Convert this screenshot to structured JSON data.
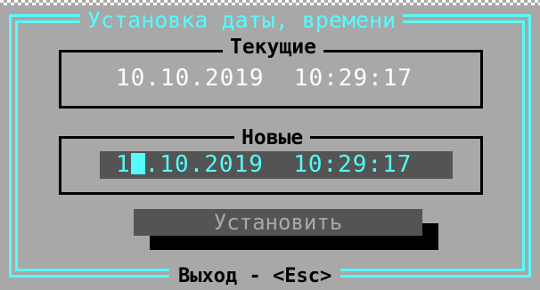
{
  "dialog": {
    "title": "Установка даты, времени",
    "accent_color": "#54fcfc",
    "background_color": "#a8a8a8"
  },
  "current": {
    "label": "Текущие",
    "value": "10.10.2019  10:29:17"
  },
  "new": {
    "label": "Новые",
    "value_before_cursor": "1",
    "value_after_cursor": ".10.2019  10:29:17"
  },
  "actions": {
    "set_label": "Установить",
    "exit_label": "Выход - <Esc>"
  }
}
